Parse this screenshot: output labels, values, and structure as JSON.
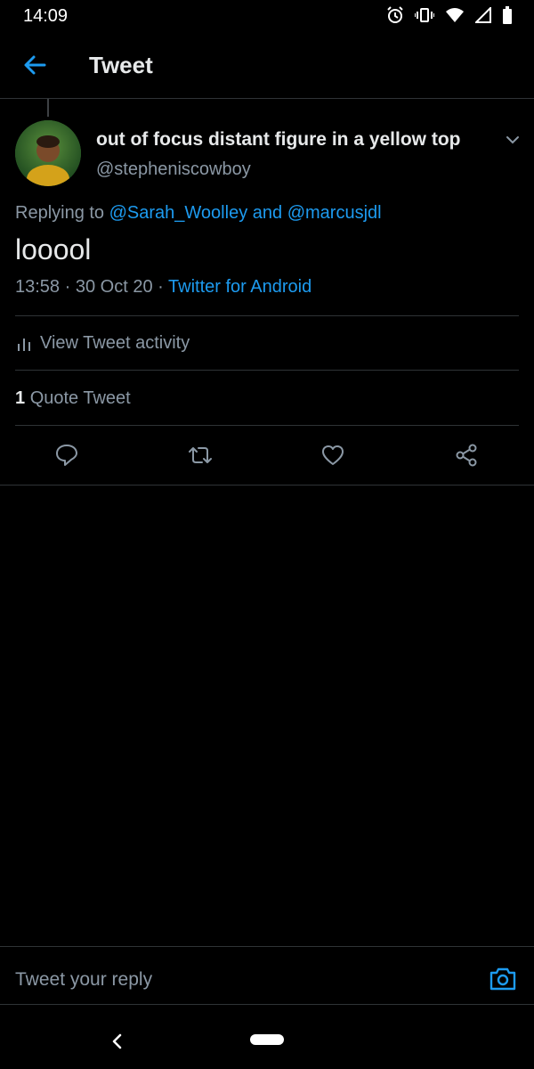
{
  "status_bar": {
    "time": "14:09",
    "icons": [
      "alarm-icon",
      "vibrate-icon",
      "wifi-icon",
      "signal-icon",
      "battery-icon"
    ]
  },
  "header": {
    "title": "Tweet",
    "back_icon": "arrow-left-icon"
  },
  "tweet": {
    "display_name": "out of focus distant figure in a yellow top",
    "handle": "@stepheniscowboy",
    "replying_prefix": "Replying to",
    "replying_user1": "@Sarah_Woolley",
    "replying_and": "and",
    "replying_user2": "@marcusjdl",
    "text": "looool",
    "time": "13:58",
    "date": "30 Oct 20",
    "separator": "·",
    "source": "Twitter for Android"
  },
  "activity": {
    "label": "View Tweet activity",
    "icon": "bar-chart-icon"
  },
  "quotes": {
    "count": "1",
    "label": "Quote Tweet"
  },
  "actions": [
    "reply-icon",
    "retweet-icon",
    "like-icon",
    "share-icon"
  ],
  "reply_bar": {
    "placeholder": "Tweet your reply",
    "camera_icon": "camera-icon"
  },
  "colors": {
    "background": "#000000",
    "accent": "#1d9bf0",
    "secondary_text": "#8b98a5",
    "divider": "#2f3336"
  }
}
